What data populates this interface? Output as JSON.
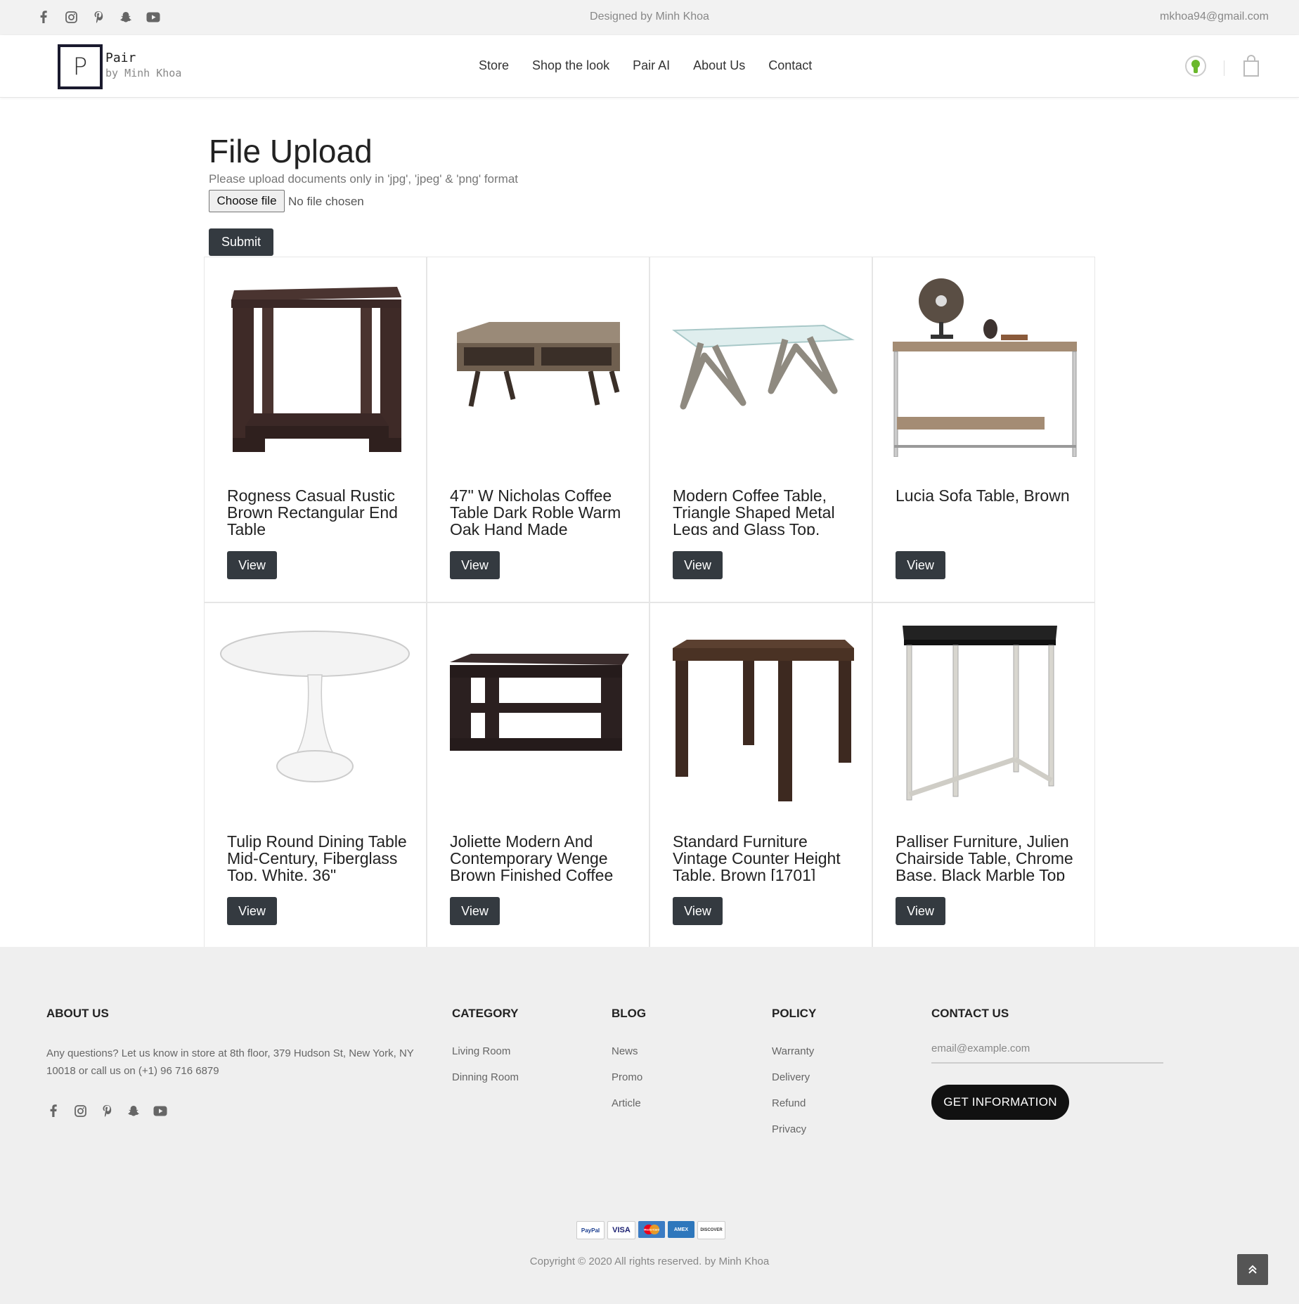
{
  "topbar": {
    "designed_by": "Designed by Minh Khoa",
    "email": "mkhoa94@gmail.com",
    "social_icons": [
      "facebook-icon",
      "instagram-icon",
      "pinterest-icon",
      "snapchat-icon",
      "youtube-icon"
    ]
  },
  "header": {
    "logo_letter": "P",
    "brand_line1": "Pair",
    "brand_line2": "by Minh Khoa",
    "nav": [
      "Store",
      "Shop the look",
      "Pair AI",
      "About Us",
      "Contact"
    ],
    "icons": [
      "user-icon",
      "cart-icon"
    ]
  },
  "upload": {
    "title": "File Upload",
    "subtitle": "Please upload documents only in 'jpg', 'jpeg' & 'png' format",
    "choose_label": "Choose file",
    "no_file_label": "No file chosen",
    "submit_label": "Submit"
  },
  "products": [
    {
      "title": "Rogness Casual Rustic Brown Rectangular End Table",
      "button": "View"
    },
    {
      "title": "47\" W Nicholas Coffee Table Dark Roble Warm Oak Hand Made",
      "button": "View"
    },
    {
      "title": "Modern Coffee Table, Triangle Shaped Metal Legs and Glass Top, Silver",
      "button": "View"
    },
    {
      "title": "Lucia Sofa Table, Brown",
      "button": "View"
    },
    {
      "title": "Tulip Round Dining Table Mid-Century, Fiberglass Top, White, 36\"",
      "button": "View"
    },
    {
      "title": "Joliette Modern And Contemporary Wenge Brown Finished Coffee Table",
      "button": "View"
    },
    {
      "title": "Standard Furniture Vintage Counter Height Table, Brown [1701]",
      "button": "View"
    },
    {
      "title": "Palliser Furniture, Julien Chairside Table, Chrome Base, Black Marble Top",
      "button": "View"
    }
  ],
  "footer": {
    "about_heading": "ABOUT US",
    "about_text": "Any questions? Let us know in store at 8th floor, 379 Hudson St, New York, NY 10018 or call us on (+1) 96 716 6879",
    "category_heading": "CATEGORY",
    "category_items": [
      "Living Room",
      "Dinning Room"
    ],
    "blog_heading": "BLOG",
    "blog_items": [
      "News",
      "Promo",
      "Article"
    ],
    "policy_heading": "POLICY",
    "policy_items": [
      "Warranty",
      "Delivery",
      "Refund",
      "Privacy"
    ],
    "contact_heading": "CONTACT US",
    "email_placeholder": "email@example.com",
    "get_info_label": "GET INFORMATION",
    "payments": [
      "PayPal",
      "VISA",
      "MasterCard",
      "AMEX",
      "DISCOVER"
    ],
    "copyright": "Copyright © 2020 All rights reserved. by Minh Khoa",
    "back_to_top_icon": "double-chevron-up-icon"
  },
  "colors": {
    "dark_button": "#343a40",
    "topbar_bg": "#f2f2f2",
    "footer_bg": "#efefef",
    "user_icon_green": "#6ab82b"
  }
}
